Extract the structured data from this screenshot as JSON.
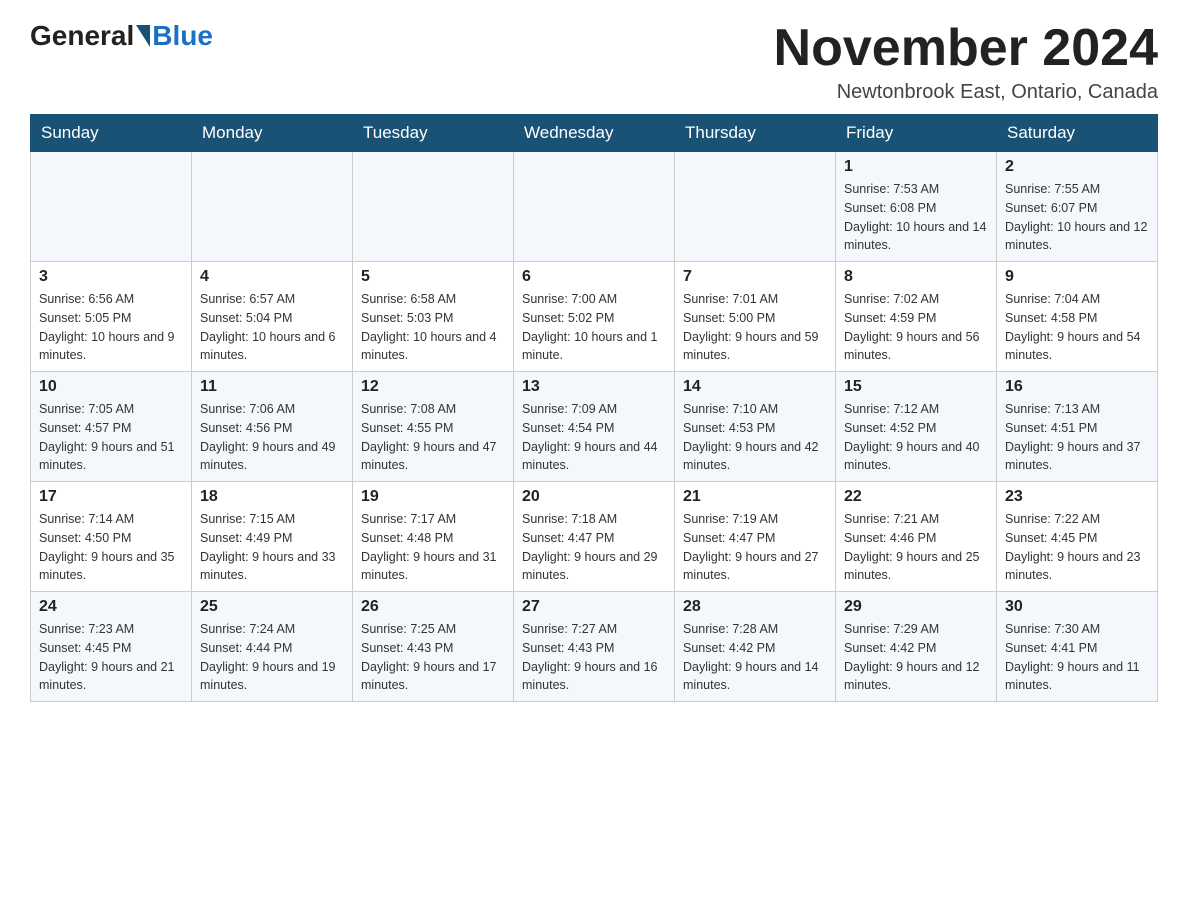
{
  "header": {
    "logo_general": "General",
    "logo_blue": "Blue",
    "month_title": "November 2024",
    "location": "Newtonbrook East, Ontario, Canada"
  },
  "weekdays": [
    "Sunday",
    "Monday",
    "Tuesday",
    "Wednesday",
    "Thursday",
    "Friday",
    "Saturday"
  ],
  "rows": [
    [
      {
        "day": "",
        "sunrise": "",
        "sunset": "",
        "daylight": ""
      },
      {
        "day": "",
        "sunrise": "",
        "sunset": "",
        "daylight": ""
      },
      {
        "day": "",
        "sunrise": "",
        "sunset": "",
        "daylight": ""
      },
      {
        "day": "",
        "sunrise": "",
        "sunset": "",
        "daylight": ""
      },
      {
        "day": "",
        "sunrise": "",
        "sunset": "",
        "daylight": ""
      },
      {
        "day": "1",
        "sunrise": "Sunrise: 7:53 AM",
        "sunset": "Sunset: 6:08 PM",
        "daylight": "Daylight: 10 hours and 14 minutes."
      },
      {
        "day": "2",
        "sunrise": "Sunrise: 7:55 AM",
        "sunset": "Sunset: 6:07 PM",
        "daylight": "Daylight: 10 hours and 12 minutes."
      }
    ],
    [
      {
        "day": "3",
        "sunrise": "Sunrise: 6:56 AM",
        "sunset": "Sunset: 5:05 PM",
        "daylight": "Daylight: 10 hours and 9 minutes."
      },
      {
        "day": "4",
        "sunrise": "Sunrise: 6:57 AM",
        "sunset": "Sunset: 5:04 PM",
        "daylight": "Daylight: 10 hours and 6 minutes."
      },
      {
        "day": "5",
        "sunrise": "Sunrise: 6:58 AM",
        "sunset": "Sunset: 5:03 PM",
        "daylight": "Daylight: 10 hours and 4 minutes."
      },
      {
        "day": "6",
        "sunrise": "Sunrise: 7:00 AM",
        "sunset": "Sunset: 5:02 PM",
        "daylight": "Daylight: 10 hours and 1 minute."
      },
      {
        "day": "7",
        "sunrise": "Sunrise: 7:01 AM",
        "sunset": "Sunset: 5:00 PM",
        "daylight": "Daylight: 9 hours and 59 minutes."
      },
      {
        "day": "8",
        "sunrise": "Sunrise: 7:02 AM",
        "sunset": "Sunset: 4:59 PM",
        "daylight": "Daylight: 9 hours and 56 minutes."
      },
      {
        "day": "9",
        "sunrise": "Sunrise: 7:04 AM",
        "sunset": "Sunset: 4:58 PM",
        "daylight": "Daylight: 9 hours and 54 minutes."
      }
    ],
    [
      {
        "day": "10",
        "sunrise": "Sunrise: 7:05 AM",
        "sunset": "Sunset: 4:57 PM",
        "daylight": "Daylight: 9 hours and 51 minutes."
      },
      {
        "day": "11",
        "sunrise": "Sunrise: 7:06 AM",
        "sunset": "Sunset: 4:56 PM",
        "daylight": "Daylight: 9 hours and 49 minutes."
      },
      {
        "day": "12",
        "sunrise": "Sunrise: 7:08 AM",
        "sunset": "Sunset: 4:55 PM",
        "daylight": "Daylight: 9 hours and 47 minutes."
      },
      {
        "day": "13",
        "sunrise": "Sunrise: 7:09 AM",
        "sunset": "Sunset: 4:54 PM",
        "daylight": "Daylight: 9 hours and 44 minutes."
      },
      {
        "day": "14",
        "sunrise": "Sunrise: 7:10 AM",
        "sunset": "Sunset: 4:53 PM",
        "daylight": "Daylight: 9 hours and 42 minutes."
      },
      {
        "day": "15",
        "sunrise": "Sunrise: 7:12 AM",
        "sunset": "Sunset: 4:52 PM",
        "daylight": "Daylight: 9 hours and 40 minutes."
      },
      {
        "day": "16",
        "sunrise": "Sunrise: 7:13 AM",
        "sunset": "Sunset: 4:51 PM",
        "daylight": "Daylight: 9 hours and 37 minutes."
      }
    ],
    [
      {
        "day": "17",
        "sunrise": "Sunrise: 7:14 AM",
        "sunset": "Sunset: 4:50 PM",
        "daylight": "Daylight: 9 hours and 35 minutes."
      },
      {
        "day": "18",
        "sunrise": "Sunrise: 7:15 AM",
        "sunset": "Sunset: 4:49 PM",
        "daylight": "Daylight: 9 hours and 33 minutes."
      },
      {
        "day": "19",
        "sunrise": "Sunrise: 7:17 AM",
        "sunset": "Sunset: 4:48 PM",
        "daylight": "Daylight: 9 hours and 31 minutes."
      },
      {
        "day": "20",
        "sunrise": "Sunrise: 7:18 AM",
        "sunset": "Sunset: 4:47 PM",
        "daylight": "Daylight: 9 hours and 29 minutes."
      },
      {
        "day": "21",
        "sunrise": "Sunrise: 7:19 AM",
        "sunset": "Sunset: 4:47 PM",
        "daylight": "Daylight: 9 hours and 27 minutes."
      },
      {
        "day": "22",
        "sunrise": "Sunrise: 7:21 AM",
        "sunset": "Sunset: 4:46 PM",
        "daylight": "Daylight: 9 hours and 25 minutes."
      },
      {
        "day": "23",
        "sunrise": "Sunrise: 7:22 AM",
        "sunset": "Sunset: 4:45 PM",
        "daylight": "Daylight: 9 hours and 23 minutes."
      }
    ],
    [
      {
        "day": "24",
        "sunrise": "Sunrise: 7:23 AM",
        "sunset": "Sunset: 4:45 PM",
        "daylight": "Daylight: 9 hours and 21 minutes."
      },
      {
        "day": "25",
        "sunrise": "Sunrise: 7:24 AM",
        "sunset": "Sunset: 4:44 PM",
        "daylight": "Daylight: 9 hours and 19 minutes."
      },
      {
        "day": "26",
        "sunrise": "Sunrise: 7:25 AM",
        "sunset": "Sunset: 4:43 PM",
        "daylight": "Daylight: 9 hours and 17 minutes."
      },
      {
        "day": "27",
        "sunrise": "Sunrise: 7:27 AM",
        "sunset": "Sunset: 4:43 PM",
        "daylight": "Daylight: 9 hours and 16 minutes."
      },
      {
        "day": "28",
        "sunrise": "Sunrise: 7:28 AM",
        "sunset": "Sunset: 4:42 PM",
        "daylight": "Daylight: 9 hours and 14 minutes."
      },
      {
        "day": "29",
        "sunrise": "Sunrise: 7:29 AM",
        "sunset": "Sunset: 4:42 PM",
        "daylight": "Daylight: 9 hours and 12 minutes."
      },
      {
        "day": "30",
        "sunrise": "Sunrise: 7:30 AM",
        "sunset": "Sunset: 4:41 PM",
        "daylight": "Daylight: 9 hours and 11 minutes."
      }
    ]
  ]
}
